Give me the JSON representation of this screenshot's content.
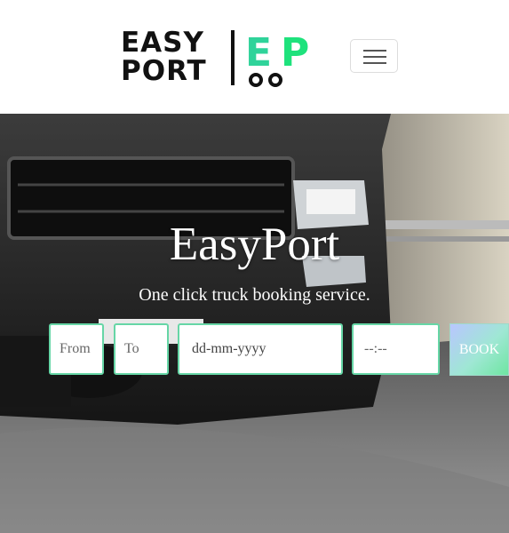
{
  "brand": {
    "logo_line1": "EASY",
    "logo_line2": "PORT",
    "logo_mark": "EP",
    "colors": {
      "e": "#2fd39a",
      "p": "#1ee27c"
    }
  },
  "nav": {
    "toggler_icon": "hamburger-menu-icon"
  },
  "hero": {
    "title": "EasyPort",
    "subtitle": "One click truck booking service."
  },
  "booking_form": {
    "from_placeholder": "From",
    "to_placeholder": "To",
    "date_placeholder": "dd-mm-yyyy",
    "time_placeholder": "--:--",
    "book_label": "BOOK"
  },
  "theme": {
    "field_border": "#66d6a6",
    "button_gradient": [
      "#b9c6ff",
      "#9fe7d4",
      "#6ee6a1"
    ]
  }
}
